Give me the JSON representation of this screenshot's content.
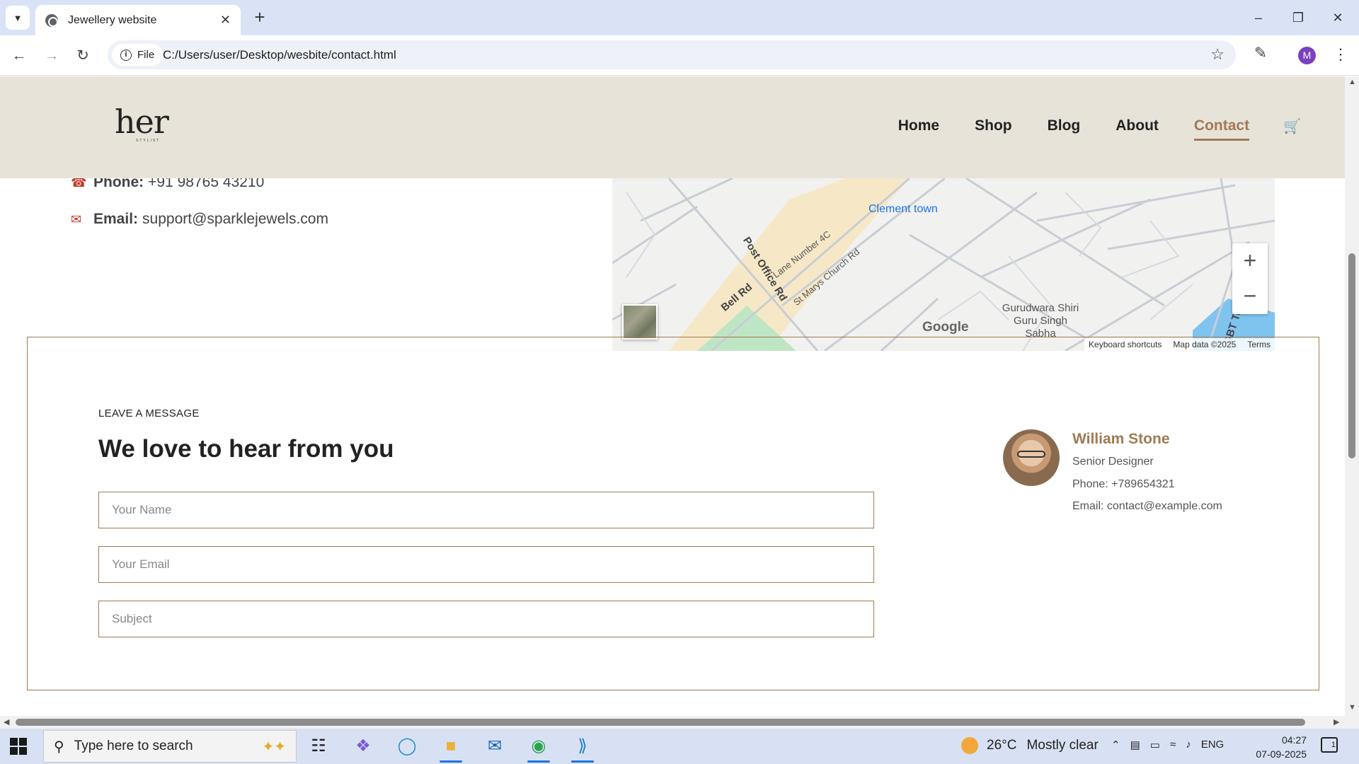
{
  "browser": {
    "tab_title": "Jewellery website",
    "chip_label": "File",
    "url": "C:/Users/user/Desktop/wesbite/contact.html",
    "profile_initial": "M"
  },
  "site": {
    "logo_text": "her",
    "logo_sub": "STYLIST",
    "nav": [
      "Home",
      "Shop",
      "Blog",
      "About",
      "Contact"
    ],
    "active_nav": "Contact"
  },
  "contact_info": {
    "phone_label": "Phone:",
    "phone_value": "+91 98765 43210",
    "email_label": "Email:",
    "email_value": "support@sparklejewels.com"
  },
  "map": {
    "place": "Clement town",
    "roads": [
      "Post Office Rd",
      "Bell Rd",
      "Lane Number 4C",
      "St Marys Church Rd",
      "GBT Turner Rd"
    ],
    "poi": "Gurudwara Shiri Guru Singh Sabha",
    "brand": "Google",
    "footer": [
      "Keyboard shortcuts",
      "Map data ©2025",
      "Terms"
    ],
    "zoom_in": "+",
    "zoom_out": "−"
  },
  "form": {
    "eyebrow": "LEAVE A MESSAGE",
    "heading": "We love to hear from you",
    "name_placeholder": "Your Name",
    "email_placeholder": "Your Email",
    "subject_placeholder": "Subject"
  },
  "card": {
    "name": "William Stone",
    "role": "Senior Designer",
    "phone": "Phone: +789654321",
    "email": "Email: contact@example.com"
  },
  "taskbar": {
    "search_placeholder": "Type here to search",
    "temperature": "26°C",
    "weather": "Mostly clear",
    "language": "ENG",
    "time": "04:27",
    "date": "07-09-2025",
    "notifications": "1"
  }
}
